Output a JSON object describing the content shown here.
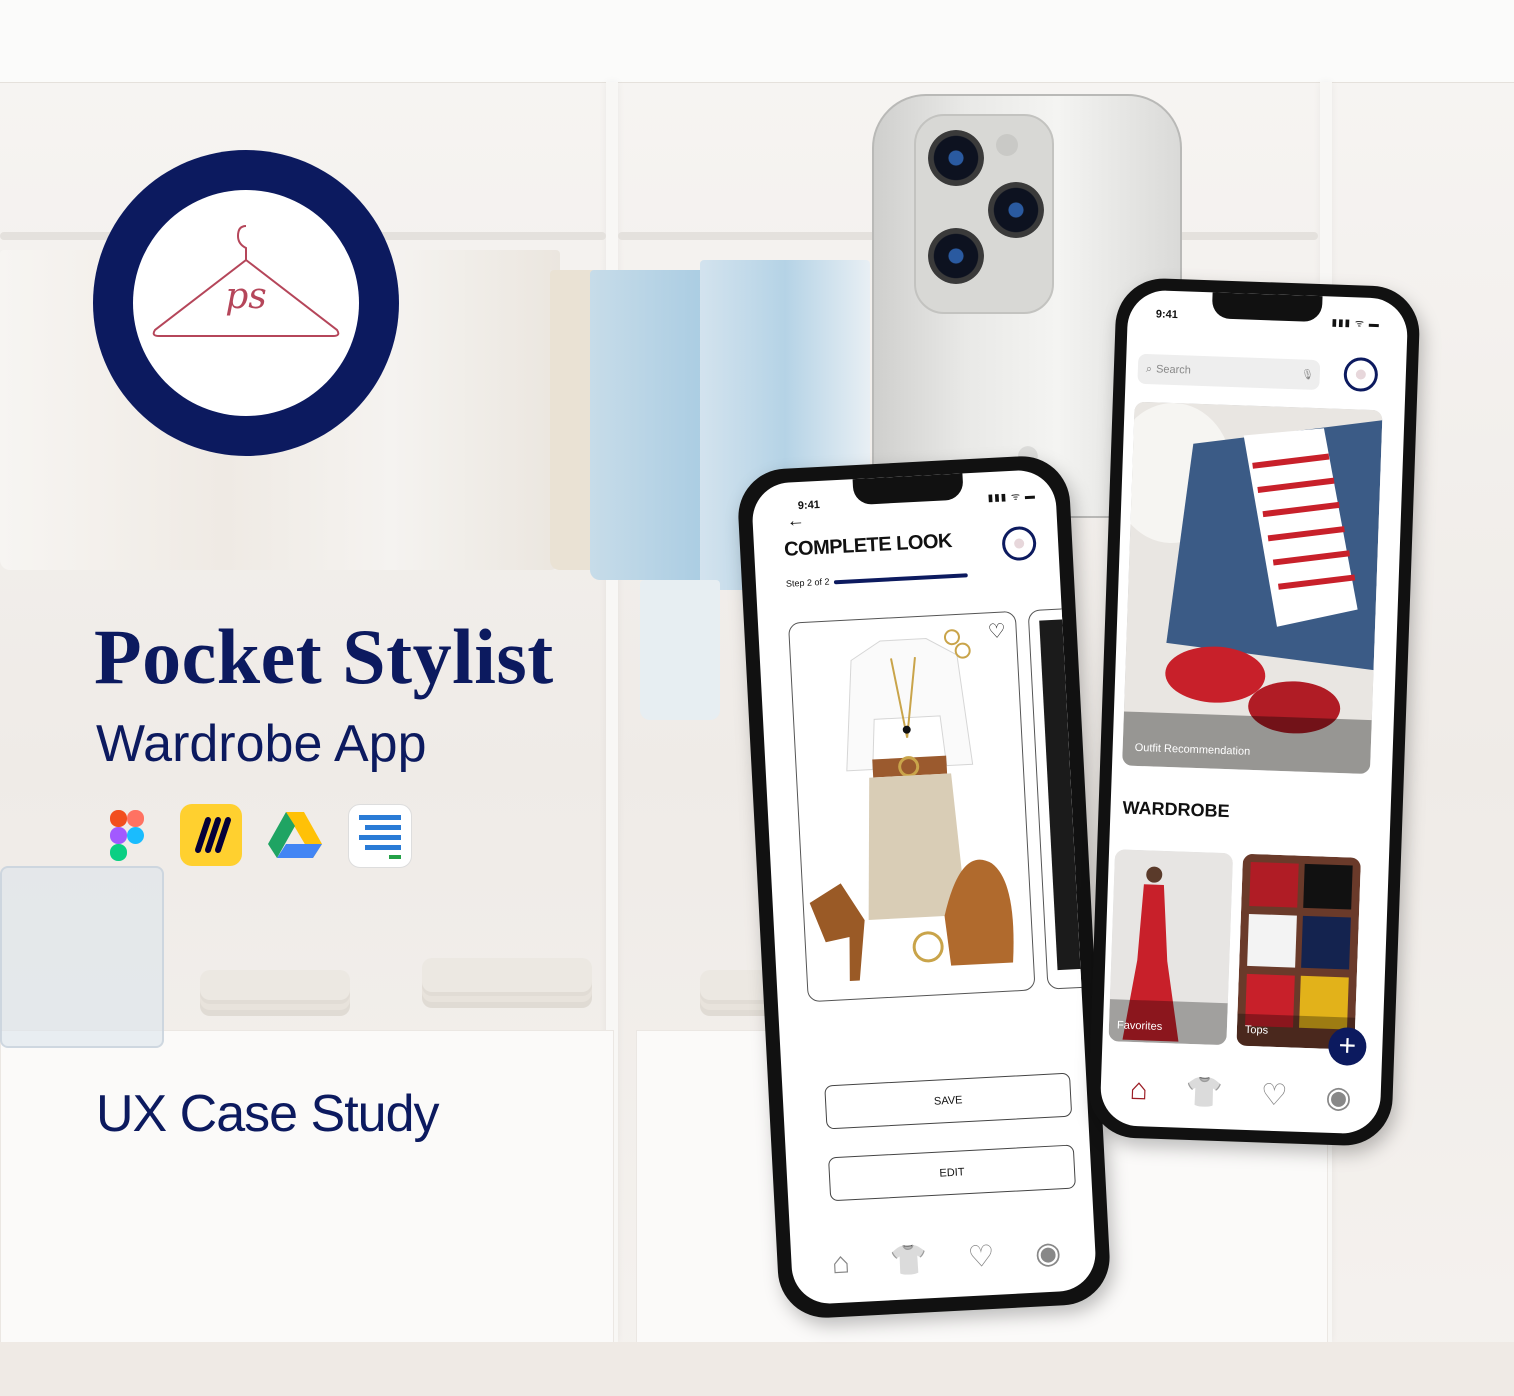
{
  "hero": {
    "logo_text": "ps",
    "title": "Pocket Stylist",
    "subtitle": "Wardrobe App",
    "tagline": "UX Case Study"
  },
  "tools": [
    {
      "name": "figma-icon",
      "color": "#f24e1e"
    },
    {
      "name": "miro-icon",
      "color": "#ffd02f"
    },
    {
      "name": "google-drive-icon",
      "color": "#1fa463"
    },
    {
      "name": "notes-list-icon",
      "color": "#2a7bd6"
    }
  ],
  "phone_left": {
    "time": "9:41",
    "status_icons": "▮▮▮ ᯤ ▬",
    "back_icon": "←",
    "title": "COMPLETE LOOK",
    "step_text": "Step 2 of 2",
    "progress_fraction": 1.0,
    "save_label": "SAVE",
    "edit_label": "EDIT",
    "nav": {
      "home": "⌂",
      "shirt": "👕",
      "heart": "♡",
      "profile": "◉"
    }
  },
  "phone_right": {
    "time": "9:41",
    "status_icons": "▮▮▮ ᯤ ▬",
    "search_placeholder": "Search",
    "mic_icon": "🎙",
    "rec_label": "Outfit Recommendation",
    "wardrobe_title": "WARDROBE",
    "tiles": [
      {
        "label": "Favorites"
      },
      {
        "label": "Tops"
      }
    ],
    "fab_label": "+",
    "nav": {
      "home": "⌂",
      "shirt": "👕",
      "heart": "♡",
      "profile": "◉"
    }
  },
  "colors": {
    "brand_navy": "#0c1a5f",
    "accent_rose": "#b5465a"
  }
}
